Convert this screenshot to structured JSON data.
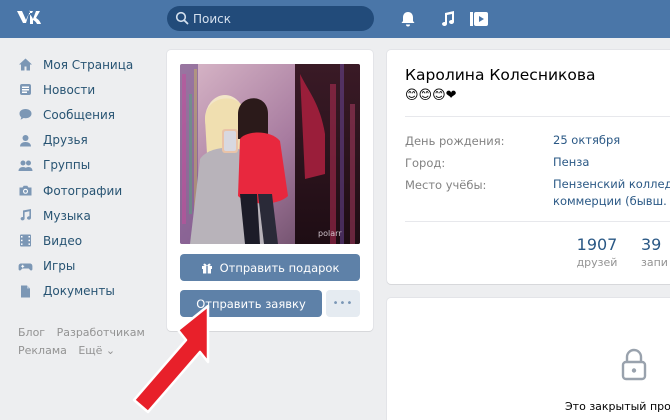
{
  "header": {
    "logo": "VK",
    "search_placeholder": "Поиск",
    "icons": [
      "bell-icon",
      "music-icon",
      "play-icon"
    ]
  },
  "sidebar": {
    "items": [
      {
        "label": "Моя Страница",
        "icon": "home-icon"
      },
      {
        "label": "Новости",
        "icon": "news-icon"
      },
      {
        "label": "Сообщения",
        "icon": "messages-icon"
      },
      {
        "label": "Друзья",
        "icon": "friends-icon"
      },
      {
        "label": "Группы",
        "icon": "groups-icon"
      },
      {
        "label": "Фотографии",
        "icon": "camera-icon"
      },
      {
        "label": "Музыка",
        "icon": "music-note-icon"
      },
      {
        "label": "Видео",
        "icon": "film-icon"
      },
      {
        "label": "Игры",
        "icon": "gamepad-icon"
      },
      {
        "label": "Документы",
        "icon": "document-icon"
      }
    ],
    "footer": {
      "blog": "Блог",
      "developers": "Разработчикам",
      "ads": "Реклама",
      "more": "Ещё ⌄"
    }
  },
  "profile": {
    "photo_watermark": "polarr",
    "gift_button": "Отправить подарок",
    "request_button": "Отправить заявку",
    "more_button": "•••",
    "name": "Каролина Колесникова",
    "status_emoji": "😊😊😊❤",
    "info": [
      {
        "label": "День рождения:",
        "value": "25 октября"
      },
      {
        "label": "Город:",
        "value": "Пенза"
      },
      {
        "label": "Место учёбы:",
        "value": "Пензенский колледж коммерции (бывш. П"
      }
    ],
    "counters": [
      {
        "num": "1907",
        "label": "друзей"
      },
      {
        "num": "39",
        "label": "запи"
      }
    ],
    "closed_text": "Это закрытый про"
  },
  "colors": {
    "header": "#4a76a8",
    "link": "#2a5885",
    "button": "#5e81a8",
    "background": "#edeef0",
    "arrow": "#e8202a"
  }
}
